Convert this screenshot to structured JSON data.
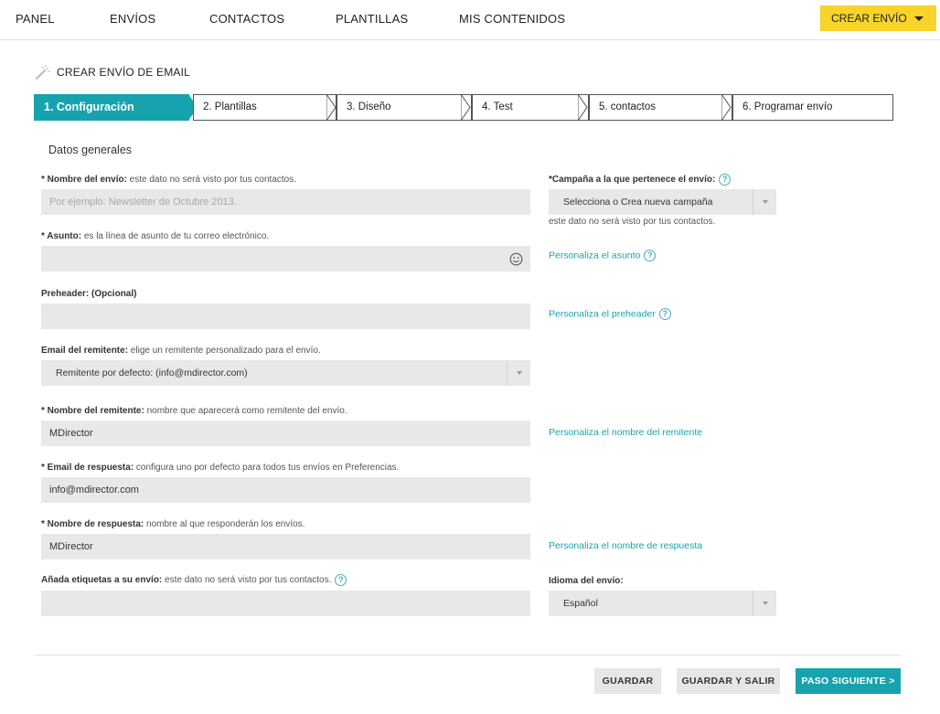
{
  "nav": {
    "items": [
      "PANEL",
      "ENVÍOS",
      "CONTACTOS",
      "PLANTILLAS",
      "MIS CONTENIDOS"
    ],
    "create_button": "CREAR ENVÍO"
  },
  "page": {
    "title": "CREAR ENVÍO DE EMAIL"
  },
  "steps": [
    "1. Configuración",
    "2. Plantillas",
    "3. Diseño",
    "4. Test",
    "5. contactos",
    "6. Programar envío"
  ],
  "section": {
    "title": "Datos generales"
  },
  "form": {
    "nombre_envio": {
      "label": "* Nombre del envío:",
      "desc": " este dato no será visto por tus contactos.",
      "placeholder": "Por ejemplo: Newsletter de Octubre 2013."
    },
    "asunto": {
      "label": "* Asunto:",
      "desc": " es la línea de asunto de tu correo electrónico.",
      "value": ""
    },
    "preheader": {
      "label": "Preheader: (Opcional)",
      "value": ""
    },
    "email_remitente": {
      "label": "Email del remitente:",
      "desc": " elige un remitente personalizado para el envío.",
      "value": "Remitente por defecto: (info@mdirector.com)"
    },
    "nombre_remitente": {
      "label": "* Nombre del remitente:",
      "desc": " nombre que aparecerá como remitente del envío.",
      "value": "MDirector"
    },
    "email_respuesta": {
      "label": "* Email de respuesta:",
      "desc": " configura uno por defecto para todos tus envíos en Preferencias.",
      "value": "info@mdirector.com"
    },
    "nombre_respuesta": {
      "label": "* Nombre de respuesta:",
      "desc": " nombre al que responderán los envíos.",
      "value": "MDirector"
    },
    "etiquetas": {
      "label": "Añada etiquetas a su envío:",
      "desc": " este dato no será visto por tus contactos.",
      "value": ""
    }
  },
  "right": {
    "campana": {
      "label": "*Campaña a la que pertenece el envío:",
      "value": "Selecciona o Crea nueva campaña",
      "hint": "este dato no será visto por tus contactos."
    },
    "link_asunto": "Personaliza el asunto",
    "link_preheader": "Personaliza el preheader",
    "link_remitente": "Personaliza el nombre del remitente",
    "link_respuesta": "Personaliza el nombre de respuesta",
    "idioma": {
      "label": "Idioma del envío:",
      "value": "Español"
    }
  },
  "help_glyph": "?",
  "footer": {
    "guardar": "GUARDAR",
    "guardar_salir": "GUARDAR Y SALIR",
    "siguiente": "PASO SIGUIENTE >"
  },
  "colors": {
    "accent": "#17a3ae",
    "create": "#f7d42a",
    "field": "#e8e8e8"
  }
}
